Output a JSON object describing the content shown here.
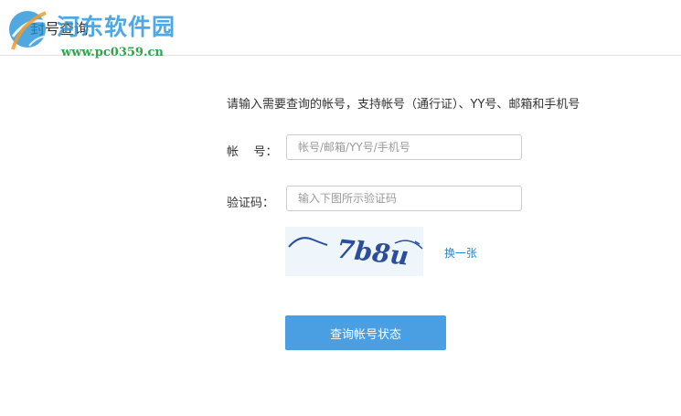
{
  "header": {
    "title": "封号查询"
  },
  "watermark": {
    "name": "河东软件园",
    "url": "www.pc0359.cn"
  },
  "form": {
    "hint": "请输入需要查询的帐号，支持帐号（通行证）、YY号、邮箱和手机号",
    "account": {
      "label": "帐    号：",
      "placeholder": "帐号/邮箱/YY号/手机号",
      "value": ""
    },
    "captcha": {
      "label": "验证码：",
      "placeholder": "输入下图所示验证码",
      "value": "",
      "image_text": "7b8u",
      "refresh_label": "换一张"
    },
    "submit_label": "查询帐号状态"
  },
  "colors": {
    "accent": "#4a9fe2",
    "link": "#2b85c6",
    "captcha_ink": "#2a4d9c"
  }
}
